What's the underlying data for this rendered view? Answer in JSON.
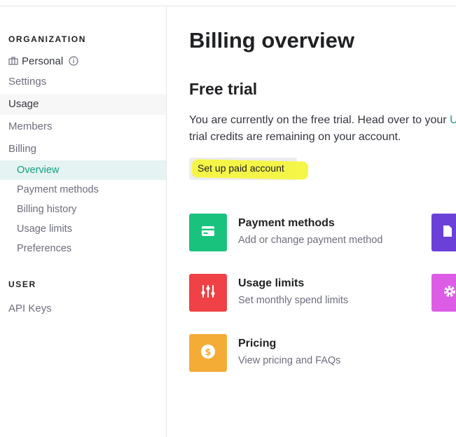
{
  "sidebar": {
    "organization_heading": "ORGANIZATION",
    "org_name": "Personal",
    "items": [
      {
        "label": "Settings"
      },
      {
        "label": "Usage"
      },
      {
        "label": "Members"
      },
      {
        "label": "Billing"
      }
    ],
    "billing_subitems": [
      {
        "label": "Overview"
      },
      {
        "label": "Payment methods"
      },
      {
        "label": "Billing history"
      },
      {
        "label": "Usage limits"
      },
      {
        "label": "Preferences"
      }
    ],
    "user_heading": "USER",
    "user_items": [
      {
        "label": "API Keys"
      }
    ]
  },
  "main": {
    "title": "Billing overview",
    "section_title": "Free trial",
    "trial_text_line1": "You are currently on the free trial. Head over to your",
    "trial_text_link": "U",
    "trial_text_line2": "trial credits are remaining on your account.",
    "setup_button_label": "Set up paid account",
    "cards": [
      {
        "title": "Payment methods",
        "description": "Add or change payment method",
        "color": "#19c37d",
        "icon": "credit-card-icon"
      },
      {
        "title": "Usage limits",
        "description": "Set monthly spend limits",
        "color": "#ef4146",
        "icon": "sliders-icon"
      },
      {
        "title": "Pricing",
        "description": "View pricing and FAQs",
        "color": "#f4ac36",
        "icon": "dollar-coin-icon"
      }
    ],
    "partial_cards": [
      {
        "color": "#6b40d8",
        "icon": "document-icon"
      },
      {
        "color": "#dd5ce5",
        "icon": "gear-icon"
      }
    ],
    "highlight_color": "#f5f53a",
    "accent_color": "#10a37f"
  }
}
